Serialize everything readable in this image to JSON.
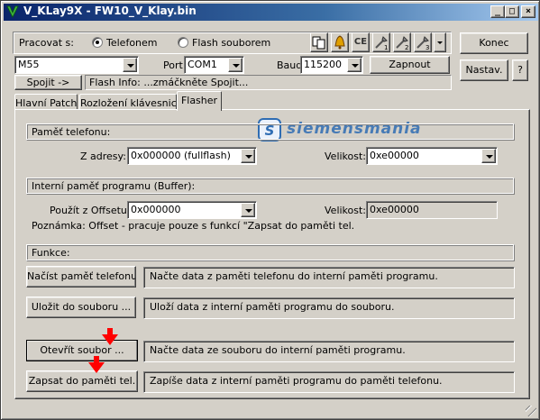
{
  "window": {
    "title": "V_KLay9X - FW10_V_Klay.bin"
  },
  "titlebar_buttons": {
    "minimize": "_",
    "maximize": "□",
    "close": "×"
  },
  "top": {
    "mode_label": "Pracovat s:",
    "mode_phone": "Telefonem",
    "mode_file": "Flash souborem",
    "mode_selected": "phone",
    "konec": "Konec",
    "nastav": "Nastav.",
    "help": "?",
    "model": "M55",
    "port_label": "Port",
    "port_value": "COM1",
    "baud_label": "Baud",
    "baud_value": "115200",
    "zapnout": "Zapnout",
    "spojit": "Spojit ->",
    "flash_info": "Flash Info: ...zmáčkněte Spojit..."
  },
  "tools": {
    "icons": [
      "copy-icon",
      "bell-icon",
      "ce-icon",
      "tool1-icon",
      "tool2-icon",
      "tool3-icon"
    ],
    "ce_text": "CE"
  },
  "tabs": [
    {
      "label": "Hlavní Patch"
    },
    {
      "label": "Rozložení klávesnice"
    },
    {
      "label": "Flasher"
    }
  ],
  "watermark": {
    "text": "siemensmania"
  },
  "flasher": {
    "phone_mem_title": "Paměť telefonu:",
    "from_addr_label": "Z adresy:",
    "from_addr_value": "0x000000 (fullflash)",
    "size_label": "Velikost:",
    "size_value": "0xe00000",
    "buffer_title": "Interní paměť programu (Buffer):",
    "offset_label": "Použít z Offsetu:",
    "offset_value": "0x000000",
    "buf_size_label": "Velikost:",
    "buf_size_value": "0xe00000",
    "note": "Poznámka: Offset - pracuje pouze s funkcí \"Zapsat do paměti tel.",
    "functions_title": "Funkce:",
    "functions": [
      {
        "button": "Načíst paměť telefonu",
        "desc": "Načte data z paměti telefonu do interní paměti programu."
      },
      {
        "button": "Uložit do souboru ...",
        "desc": "Uloží data z interní paměti programu do souboru."
      },
      {
        "button": "Otevřít soubor ...",
        "desc": "Načte data ze souboru do interní paměti programu."
      },
      {
        "button": "Zapsat do paměti tel.",
        "desc": "Zapíše data z interní paměti programu do paměti telefonu."
      }
    ]
  },
  "colors": {
    "titlebar": "#0a246a",
    "face": "#d4d0c8",
    "arrow": "#ff0000",
    "watermark": "#2f6db3"
  }
}
